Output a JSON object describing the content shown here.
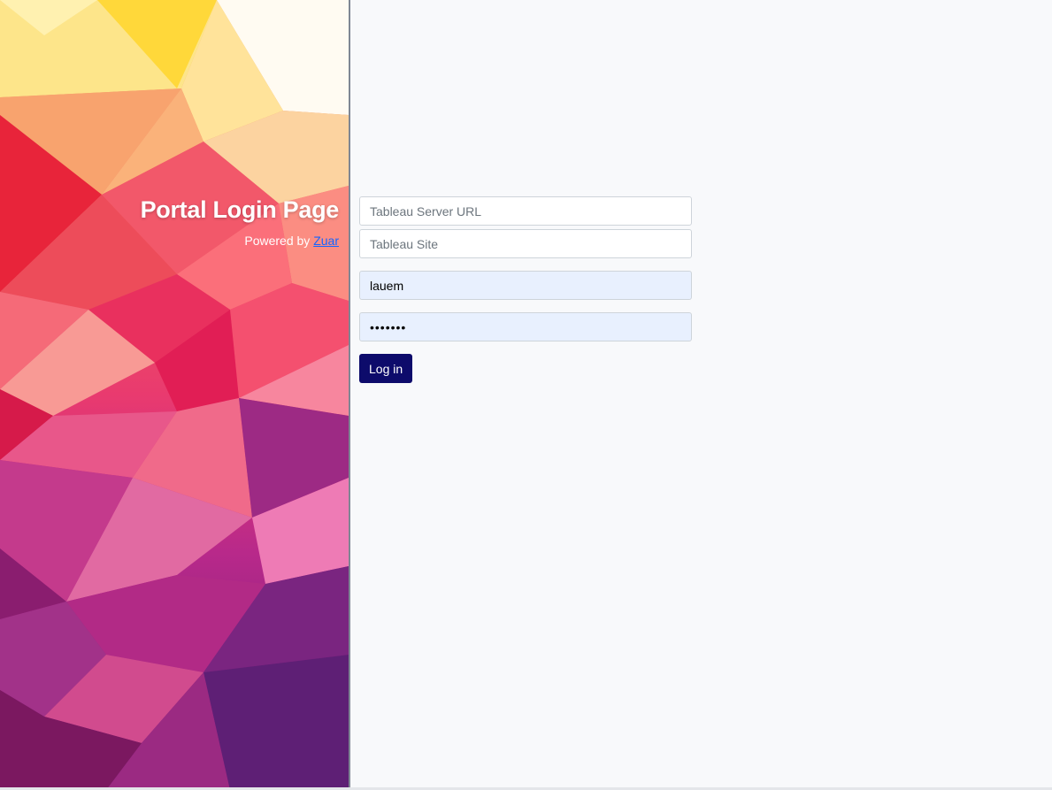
{
  "hero": {
    "title": "Portal Login Page",
    "powered_prefix": "Powered by ",
    "powered_link": "Zuar"
  },
  "form": {
    "server_url_placeholder": "Tableau Server URL",
    "server_url_value": "",
    "site_placeholder": "Tableau Site",
    "site_value": "",
    "username_value": "lauem",
    "password_value": "•••••••",
    "login_label": "Log in"
  },
  "colors": {
    "button_bg": "#0d0b6b",
    "autofill_bg": "#e8f0fe",
    "link": "#1565ff",
    "page_bg": "#f8f9fb"
  }
}
